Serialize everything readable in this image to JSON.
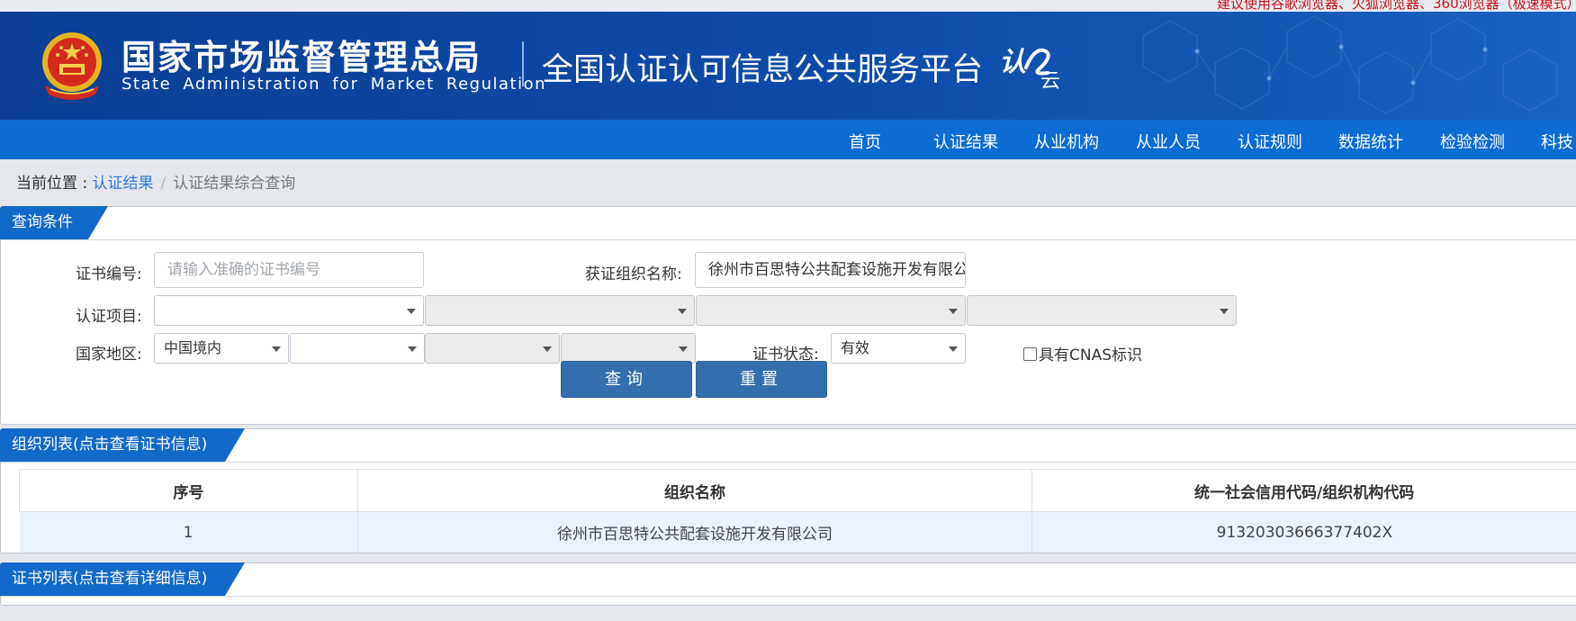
{
  "top_notice": "建议使用谷歌浏览器、火狐浏览器、360浏览器（极速模式）",
  "header": {
    "agency_cn": "国家市场监督管理总局",
    "agency_en": "State Administration  for  Market Regulation",
    "platform": "全国认证认可信息公共服务平台",
    "logo_text": "认云"
  },
  "nav": [
    "首页",
    "认证结果",
    "从业机构",
    "从业人员",
    "认证规则",
    "数据统计",
    "检验检测",
    "科技"
  ],
  "breadcrumb": {
    "prefix": "当前位置 : ",
    "link": "认证结果",
    "separator": "/",
    "current": "认证结果综合查询"
  },
  "query": {
    "title": "查询条件",
    "cert_no": {
      "label": "证书编号:",
      "placeholder": "请输入准确的证书编号",
      "value": ""
    },
    "org_name": {
      "label": "获证组织名称:",
      "value": "徐州市百思特公共配套设施开发有限公司"
    },
    "project": {
      "label": "认证项目:",
      "selects": [
        "",
        "",
        "",
        ""
      ]
    },
    "region": {
      "label": "国家地区:",
      "selects": [
        "中国境内",
        "",
        "",
        ""
      ]
    },
    "status": {
      "label": "证书状态:",
      "value": "有效"
    },
    "cnas_label": "具有CNAS标识",
    "cnas_checked": false,
    "search_label": "查询",
    "reset_label": "重置"
  },
  "org_list": {
    "title": "组织列表(点击查看证书信息)",
    "columns": [
      "序号",
      "组织名称",
      "统一社会信用代码/组织机构代码"
    ],
    "rows": [
      [
        "1",
        "徐州市百思特公共配套设施开发有限公司",
        "91320303666377402X"
      ]
    ]
  },
  "cert_list": {
    "title": "证书列表(点击查看详细信息)"
  },
  "colors": {
    "banner": "#0d4ba8",
    "nav": "#0d6bd4",
    "tab": "#1269c9",
    "button": "#346eae",
    "notice": "#c8101a",
    "link": "#2f7bd4",
    "row_highlight": "#eaf2fc"
  }
}
